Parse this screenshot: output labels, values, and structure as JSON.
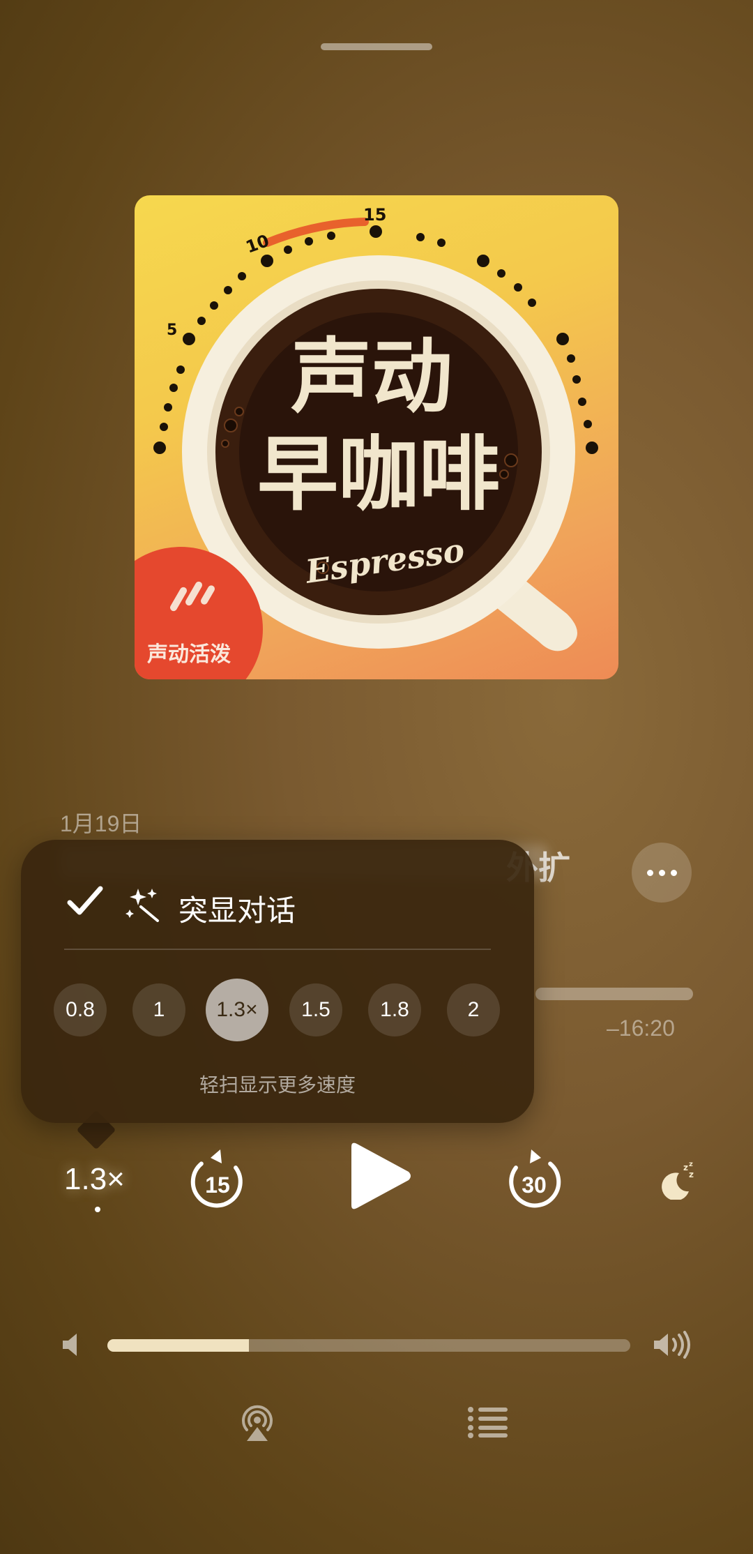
{
  "artwork": {
    "title_line1": "声动",
    "title_line2": "早咖啡",
    "subtitle": "Espresso",
    "badge": "声动活泼",
    "dial_labels": [
      "5",
      "10",
      "15"
    ],
    "accent": "#f0c84a"
  },
  "episode": {
    "date": "1月19日",
    "title_visible_tail": "外扩"
  },
  "progress": {
    "remaining": "–16:20"
  },
  "popover": {
    "highlight_dialogue": "突显对话",
    "speeds": [
      "0.8",
      "1",
      "1.3×",
      "1.5",
      "1.8",
      "2"
    ],
    "selected_speed": "1.3×",
    "hint": "轻扫显示更多速度"
  },
  "controls": {
    "rate": "1.3×",
    "skip_back": "15",
    "skip_forward": "30"
  },
  "volume": {
    "level": 0.27
  },
  "icons": {
    "more": "ellipsis-icon",
    "airplay": "airplay-audio-icon",
    "queue": "list-icon",
    "sleep": "moon-zzz-icon"
  }
}
